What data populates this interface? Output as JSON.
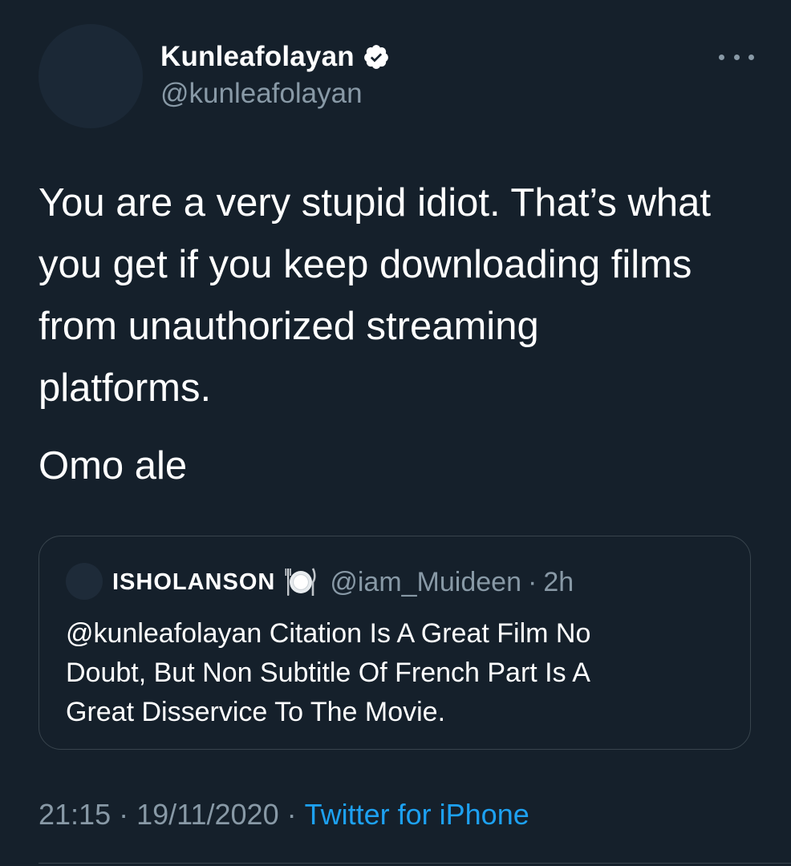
{
  "author": {
    "name": "Kunleafolayan",
    "handle": "@kunleafolayan",
    "verified_icon": "verified-badge-icon"
  },
  "tweet": {
    "text": "You are a very stupid idiot. That’s what\nyou get if you keep downloading films\nfrom unauthorized streaming\nplatforms.",
    "text2": "Omo ale"
  },
  "quoted": {
    "name": "ISHOLANSON",
    "emoji_icon": "plate-with-cutlery-icon",
    "handle": "@iam_Muideen",
    "dot": "·",
    "time": "2h",
    "text": "@kunleafolayan  Citation Is A Great Film No\nDoubt, But Non Subtitle Of French Part Is A\nGreat Disservice To The Movie."
  },
  "meta": {
    "time": "21:15",
    "sep1": "·",
    "date": "19/11/2020",
    "sep2": "·",
    "source": "Twitter for iPhone"
  },
  "colors": {
    "background": "#15202b",
    "text_primary": "#ffffff",
    "text_secondary": "#8899a6",
    "accent": "#1da1f2",
    "border": "#38444d"
  }
}
